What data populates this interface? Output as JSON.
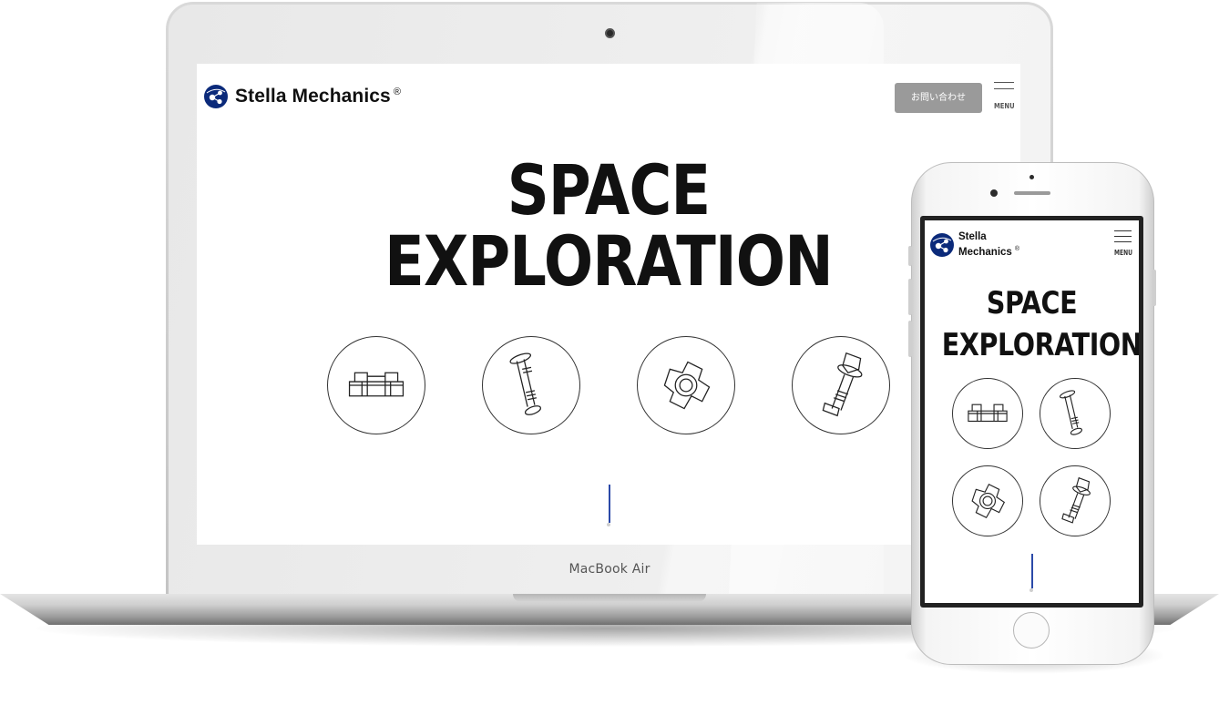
{
  "brand": {
    "name": "Stella Mechanics",
    "registered_mark": "®",
    "logo_color": "#0b2a7a"
  },
  "laptop": {
    "model_label": "MacBook Air",
    "site": {
      "contact_button": "お問い合わせ",
      "menu_label": "MENU",
      "hero_line1": "SPACE",
      "hero_line2": "EXPLORATION",
      "parts": [
        {
          "icon": "castle-nut-icon"
        },
        {
          "icon": "clevis-pin-icon"
        },
        {
          "icon": "tee-nut-icon"
        },
        {
          "icon": "flange-bolt-icon"
        }
      ]
    }
  },
  "phone": {
    "site": {
      "logo_line1": "Stella",
      "logo_line2": "Mechanics",
      "menu_label": "MENU",
      "hero_line1": "SPACE",
      "hero_line2": "EXPLORATION",
      "parts": [
        {
          "icon": "castle-nut-icon"
        },
        {
          "icon": "clevis-pin-icon"
        },
        {
          "icon": "tee-nut-icon"
        },
        {
          "icon": "flange-bolt-icon"
        }
      ]
    }
  },
  "colors": {
    "accent_scroll": "#2b4aa8",
    "contact_button_bg": "#9a9a9a"
  }
}
